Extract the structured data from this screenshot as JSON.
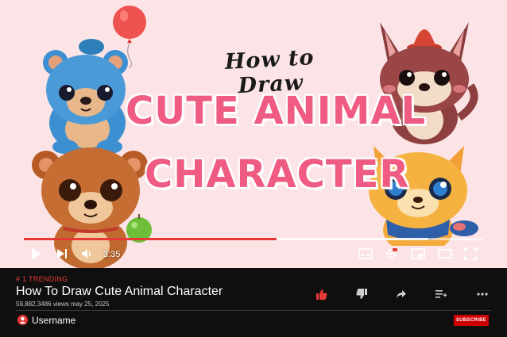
{
  "video": {
    "script_title": "How to Draw",
    "title_line_1": "CUTE ANIMAL",
    "title_line_2": "CHARACTER",
    "player": {
      "time": "3:35",
      "progress": 0.55,
      "buffered": 0.88
    }
  },
  "meta": {
    "trending": "# 1 TRENDING",
    "title": "How To Draw Cute Animal Character",
    "views": "59,882,3486 views  may  25, 2025",
    "channel_name": "Username",
    "subscribe_label": "SUBSCRIBE"
  },
  "colors": {
    "accent": "#e53935",
    "title_pink": "#ef5b82",
    "background_pink": "#fce4e6",
    "dark": "#0f0f0f"
  },
  "icons": [
    "play-icon",
    "next-icon",
    "volume-icon",
    "subtitles-icon",
    "settings-icon",
    "miniplayer-icon",
    "theater-icon",
    "fullscreen-icon",
    "like-icon",
    "dislike-icon",
    "share-icon",
    "save-icon",
    "more-icon",
    "avatar-icon"
  ]
}
